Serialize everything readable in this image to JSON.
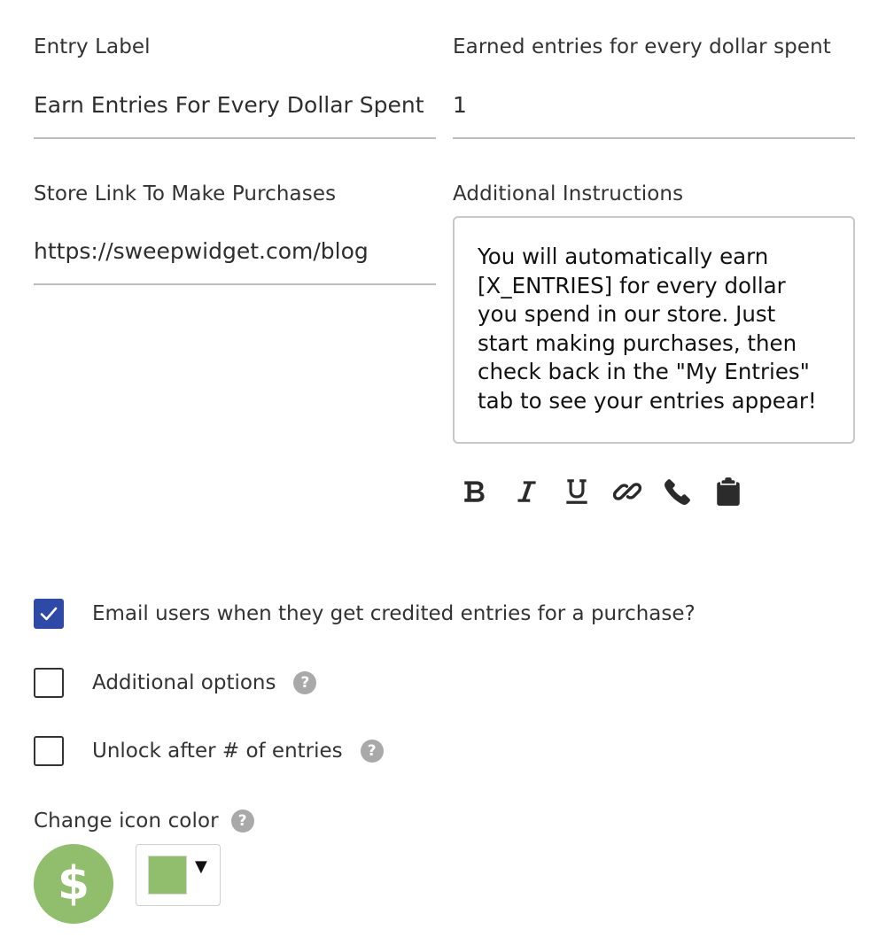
{
  "entry_label": {
    "label": "Entry Label",
    "value": "Earn Entries For Every Dollar Spent"
  },
  "earned_entries": {
    "label": "Earned entries for every dollar spent",
    "value": "1"
  },
  "store_link": {
    "label": "Store Link To Make Purchases",
    "value": "https://sweepwidget.com/blog"
  },
  "additional_instructions": {
    "label": "Additional Instructions",
    "value": "You will automatically earn\n[X_ENTRIES] for every dollar\nyou spend in our store. Just\nstart making purchases, then\ncheck back in the \"My Entries\"\ntab to see your entries appear!"
  },
  "toolbar": {
    "items": [
      "bold-icon",
      "italic-icon",
      "underline-icon",
      "link-icon",
      "phone-icon",
      "clipboard-icon"
    ]
  },
  "options": {
    "email_users": {
      "label": "Email users when they get credited entries for a purchase?",
      "checked": true
    },
    "additional_options": {
      "label": "Additional options",
      "checked": false,
      "help": "?"
    },
    "unlock_after": {
      "label": "Unlock after # of entries",
      "checked": false,
      "help": "?"
    }
  },
  "icon_color": {
    "label": "Change icon color",
    "help": "?",
    "icon": "dollar-icon",
    "icon_glyph": "$",
    "color": "#90be6c",
    "picker_caret": "▼"
  },
  "colors": {
    "accent": "#2f4aa6",
    "icon_color": "#90be6c"
  }
}
